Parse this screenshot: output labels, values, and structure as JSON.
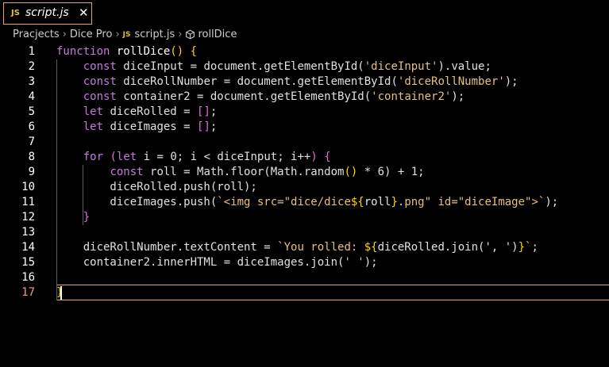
{
  "tab": {
    "badge": "JS",
    "filename": "script.js",
    "close": "✕"
  },
  "breadcrumb": {
    "items": [
      "Pracjects",
      "Dice Pro",
      "script.js",
      "rollDice"
    ],
    "js_badge": "JS"
  },
  "editor": {
    "active_line": 17,
    "lines": [
      {
        "n": "1"
      },
      {
        "n": "2"
      },
      {
        "n": "3"
      },
      {
        "n": "4"
      },
      {
        "n": "5"
      },
      {
        "n": "6"
      },
      {
        "n": "7"
      },
      {
        "n": "8"
      },
      {
        "n": "9"
      },
      {
        "n": "10"
      },
      {
        "n": "11"
      },
      {
        "n": "12"
      },
      {
        "n": "13"
      },
      {
        "n": "14"
      },
      {
        "n": "15"
      },
      {
        "n": "16"
      },
      {
        "n": "17"
      }
    ],
    "code": {
      "l1": [
        "function",
        " rollDice",
        "()",
        " ",
        "{"
      ],
      "l2": [
        "    ",
        "const",
        " diceInput = document.getElementById(",
        "'diceInput'",
        ").value;"
      ],
      "l3": [
        "    ",
        "const",
        " diceRollNumber = document.getElementById(",
        "'diceRollNumber'",
        ");"
      ],
      "l4": [
        "    ",
        "const",
        " container2 = document.getElementById(",
        "'container2'",
        ");"
      ],
      "l5": [
        "    ",
        "let",
        " diceRolled = ",
        "[]",
        ";"
      ],
      "l6": [
        "    ",
        "let",
        " diceImages = ",
        "[]",
        ";"
      ],
      "l8": [
        "    ",
        "for",
        " ",
        "(",
        "let",
        " i = 0; i < diceInput; i++",
        ")",
        " ",
        "{"
      ],
      "l9": [
        "        ",
        "const",
        " roll = Math.floor(Math.random",
        "()",
        " * 6) + 1;"
      ],
      "l10": [
        "        diceRolled.push(roll);"
      ],
      "l11": [
        "        diceImages.push(",
        "`<img src=\"dice/dice",
        "${",
        "roll",
        "}",
        ".png\" id=\"diceImage\">`",
        ");"
      ],
      "l12": [
        "    ",
        "}"
      ],
      "l14": [
        "    diceRollNumber.textContent = ",
        "`You rolled: ",
        "${",
        "diceRolled.join(', ')",
        "}",
        "`",
        ";"
      ],
      "l15": [
        "    container2.innerHTML = diceImages.join(",
        "' '",
        ");"
      ],
      "l17": [
        "}"
      ]
    }
  },
  "colors": {
    "accent": "#f0a060",
    "keyword": "#c678dd",
    "string": "#e6c07b",
    "bracket": "#ffd700"
  }
}
